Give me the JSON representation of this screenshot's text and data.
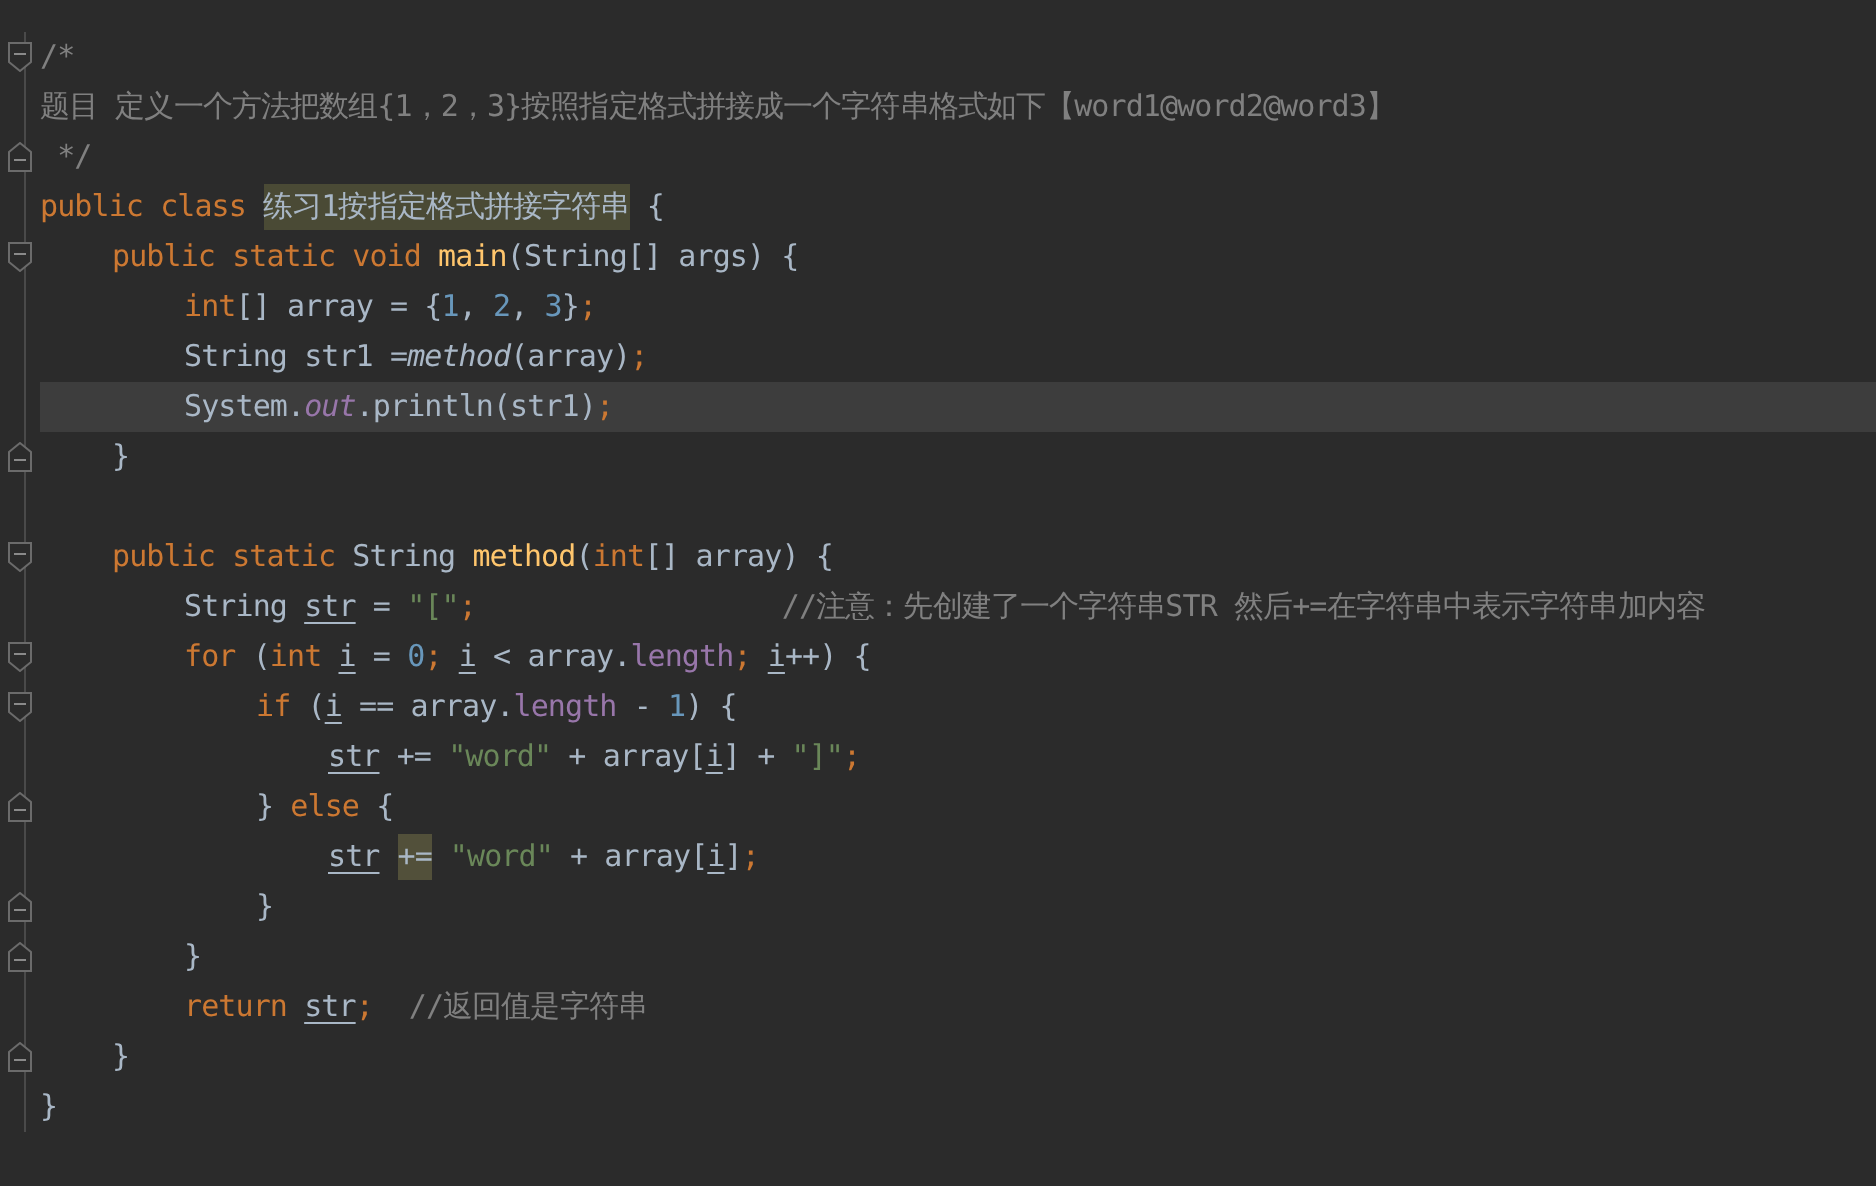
{
  "editor": {
    "lines": [
      {
        "kind": "fold-start",
        "current": false,
        "tokens": [
          {
            "kind": "comment",
            "text": "/*"
          }
        ]
      },
      {
        "kind": "code",
        "current": false,
        "tokens": [
          {
            "kind": "comment",
            "text": "题目 定义一个方法把数组{1，2，3}按照指定格式拼接成一个字符串格式如下【word1@word2@word3】"
          }
        ]
      },
      {
        "kind": "fold-end",
        "current": false,
        "tokens": [
          {
            "kind": "comment",
            "text": " */"
          }
        ]
      },
      {
        "kind": "code",
        "current": false,
        "tokens": [
          {
            "kind": "keyword",
            "text": "public class "
          },
          {
            "kind": "class-highlight",
            "text": "练习1按指定格式拼接字符串"
          },
          {
            "kind": "plain",
            "text": " {"
          }
        ]
      },
      {
        "kind": "fold-start",
        "current": false,
        "tokens": [
          {
            "kind": "keyword",
            "text": "public static void "
          },
          {
            "kind": "decl",
            "text": "main"
          },
          {
            "kind": "plain",
            "text": "(String[] args) {"
          }
        ]
      },
      {
        "kind": "code",
        "current": false,
        "tokens": [
          {
            "kind": "keyword",
            "text": "int"
          },
          {
            "kind": "plain",
            "text": "[] array = {"
          },
          {
            "kind": "number",
            "text": "1"
          },
          {
            "kind": "plain",
            "text": ", "
          },
          {
            "kind": "number",
            "text": "2"
          },
          {
            "kind": "plain",
            "text": ", "
          },
          {
            "kind": "number",
            "text": "3"
          },
          {
            "kind": "plain",
            "text": "}"
          },
          {
            "kind": "keyword",
            "text": ";"
          }
        ]
      },
      {
        "kind": "code",
        "current": false,
        "tokens": [
          {
            "kind": "plain",
            "text": "String str1 ="
          },
          {
            "kind": "call",
            "text": "method"
          },
          {
            "kind": "plain",
            "text": "(array)"
          },
          {
            "kind": "keyword",
            "text": ";"
          }
        ]
      },
      {
        "kind": "code",
        "current": true,
        "tokens": [
          {
            "kind": "plain",
            "text": "System."
          },
          {
            "kind": "static-field",
            "text": "out"
          },
          {
            "kind": "plain",
            "text": ".println(str1)"
          },
          {
            "kind": "keyword",
            "text": ";"
          }
        ]
      },
      {
        "kind": "fold-end",
        "current": false,
        "tokens": [
          {
            "kind": "plain",
            "text": "}"
          }
        ]
      },
      {
        "kind": "blank",
        "current": false
      },
      {
        "kind": "fold-start",
        "current": false,
        "tokens": [
          {
            "kind": "keyword",
            "text": "public static "
          },
          {
            "kind": "plain",
            "text": "String "
          },
          {
            "kind": "decl",
            "text": "method"
          },
          {
            "kind": "plain",
            "text": "("
          },
          {
            "kind": "keyword",
            "text": "int"
          },
          {
            "kind": "plain",
            "text": "[] array) {"
          }
        ]
      },
      {
        "kind": "code",
        "current": false,
        "tokens": [
          {
            "kind": "plain",
            "text": "String "
          },
          {
            "kind": "var",
            "text": "str"
          },
          {
            "kind": "plain",
            "text": " = "
          },
          {
            "kind": "string",
            "text": "\"[\""
          },
          {
            "kind": "keyword",
            "text": ";"
          },
          {
            "kind": "aligned-comment",
            "text": "//注意：先创建了一个字符串STR 然后+=在字符串中表示字符串加内容"
          }
        ]
      },
      {
        "kind": "fold-start",
        "current": false,
        "tokens": [
          {
            "kind": "keyword",
            "text": "for "
          },
          {
            "kind": "plain",
            "text": "("
          },
          {
            "kind": "keyword",
            "text": "int "
          },
          {
            "kind": "var",
            "text": "i"
          },
          {
            "kind": "plain",
            "text": " = "
          },
          {
            "kind": "number",
            "text": "0"
          },
          {
            "kind": "keyword",
            "text": "; "
          },
          {
            "kind": "var",
            "text": "i"
          },
          {
            "kind": "plain",
            "text": " < array."
          },
          {
            "kind": "field",
            "text": "length"
          },
          {
            "kind": "keyword",
            "text": "; "
          },
          {
            "kind": "var",
            "text": "i"
          },
          {
            "kind": "plain",
            "text": "++) {"
          }
        ]
      },
      {
        "kind": "fold-start",
        "current": false,
        "tokens": [
          {
            "kind": "keyword",
            "text": "if "
          },
          {
            "kind": "plain",
            "text": "("
          },
          {
            "kind": "var",
            "text": "i"
          },
          {
            "kind": "plain",
            "text": " == array."
          },
          {
            "kind": "field",
            "text": "length"
          },
          {
            "kind": "plain",
            "text": " - "
          },
          {
            "kind": "number",
            "text": "1"
          },
          {
            "kind": "plain",
            "text": ") {"
          }
        ]
      },
      {
        "kind": "code",
        "current": false,
        "tokens": [
          {
            "kind": "var",
            "text": "str"
          },
          {
            "kind": "plain",
            "text": " += "
          },
          {
            "kind": "string",
            "text": "\"word\""
          },
          {
            "kind": "plain",
            "text": " + array["
          },
          {
            "kind": "var",
            "text": "i"
          },
          {
            "kind": "plain",
            "text": "] + "
          },
          {
            "kind": "string",
            "text": "\"]\""
          },
          {
            "kind": "keyword",
            "text": ";"
          }
        ]
      },
      {
        "kind": "fold-end",
        "current": false,
        "tokens": [
          {
            "kind": "plain",
            "text": "} "
          },
          {
            "kind": "keyword",
            "text": "else"
          },
          {
            "kind": "plain",
            "text": " {"
          }
        ]
      },
      {
        "kind": "code",
        "current": false,
        "tokens": [
          {
            "kind": "var",
            "text": "str"
          },
          {
            "kind": "match",
            "text": "+="
          },
          {
            "kind": "string",
            "text": "\"word\""
          },
          {
            "kind": "plain",
            "text": " + array["
          },
          {
            "kind": "var",
            "text": "i"
          },
          {
            "kind": "plain",
            "text": "]"
          },
          {
            "kind": "keyword",
            "text": ";"
          }
        ]
      },
      {
        "kind": "fold-end",
        "current": false,
        "tokens": [
          {
            "kind": "plain",
            "text": "}"
          }
        ]
      },
      {
        "kind": "fold-end",
        "current": false,
        "tokens": [
          {
            "kind": "plain",
            "text": "}"
          }
        ]
      },
      {
        "kind": "code",
        "current": false,
        "tokens": [
          {
            "kind": "keyword",
            "text": "return "
          },
          {
            "kind": "var",
            "text": "str"
          },
          {
            "kind": "keyword",
            "text": ";"
          },
          {
            "kind": "end-comment",
            "text": "//返回值是字符串"
          }
        ]
      },
      {
        "kind": "fold-end",
        "current": false,
        "tokens": [
          {
            "kind": "plain",
            "text": "}"
          }
        ]
      },
      {
        "kind": "code",
        "current": false,
        "tokens": [
          {
            "kind": "plain",
            "text": "}"
          }
        ]
      }
    ]
  }
}
